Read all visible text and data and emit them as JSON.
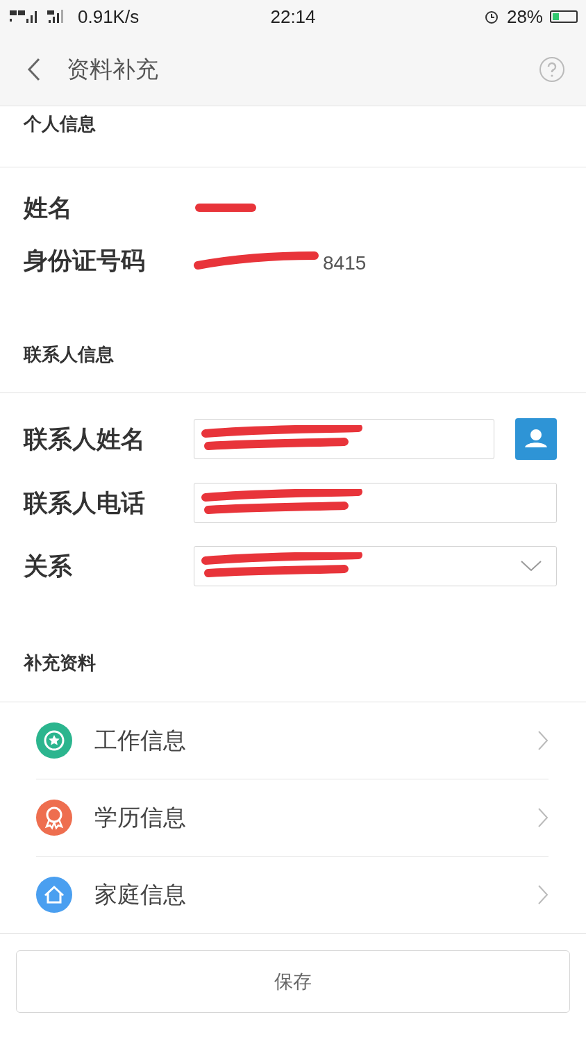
{
  "status_bar": {
    "network": "0.91K/s",
    "time": "22:14",
    "battery": "28%"
  },
  "header": {
    "title": "资料补充"
  },
  "personal": {
    "title": "个人信息",
    "rows": [
      {
        "label": "姓名",
        "value": ""
      },
      {
        "label": "身份证号码",
        "value": "8415"
      }
    ]
  },
  "contact": {
    "title": "联系人信息",
    "fields": [
      {
        "label": "联系人姓名",
        "kind": "input"
      },
      {
        "label": "联系人电话",
        "kind": "input"
      },
      {
        "label": "关系",
        "kind": "select"
      }
    ]
  },
  "supplement": {
    "title": "补充资料",
    "items": [
      {
        "label": "工作信息",
        "kind": "work",
        "color": "#2bb58e"
      },
      {
        "label": "学历信息",
        "kind": "education",
        "color": "#ee6e4f"
      },
      {
        "label": "家庭信息",
        "kind": "family",
        "color": "#4a9ff0"
      }
    ]
  },
  "save_button": "保存"
}
